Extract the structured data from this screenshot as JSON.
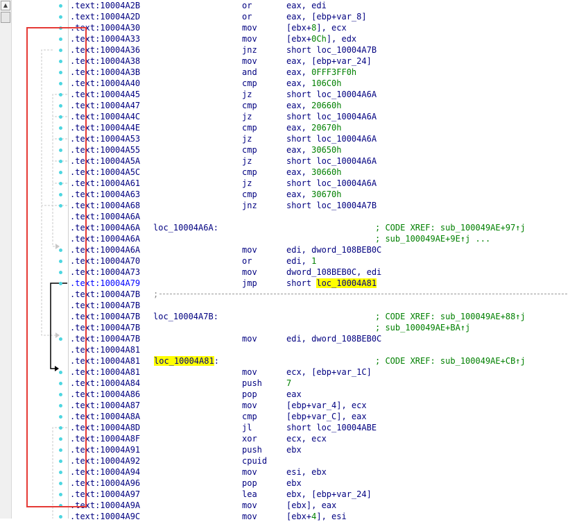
{
  "scrollbar": {
    "up_arrow": "▲"
  },
  "rows": [
    {
      "addr": ".text:10004A2B",
      "label": "",
      "mnemonic": "or",
      "operands": "eax, edi",
      "comment": ""
    },
    {
      "addr": ".text:10004A2D",
      "label": "",
      "mnemonic": "or",
      "operands": "eax, [ebp+var_8]",
      "comment": ""
    },
    {
      "addr": ".text:10004A30",
      "label": "",
      "mnemonic": "mov",
      "operands": "[ebx+8], ecx",
      "comment": ""
    },
    {
      "addr": ".text:10004A33",
      "label": "",
      "mnemonic": "mov",
      "operands": "[ebx+0Ch], edx",
      "comment": ""
    },
    {
      "addr": ".text:10004A36",
      "label": "",
      "mnemonic": "jnz",
      "operands": "short loc_10004A7B",
      "comment": ""
    },
    {
      "addr": ".text:10004A38",
      "label": "",
      "mnemonic": "mov",
      "operands": "eax, [ebp+var_24]",
      "comment": ""
    },
    {
      "addr": ".text:10004A3B",
      "label": "",
      "mnemonic": "and",
      "operands": "eax, 0FFF3FF0h",
      "comment": ""
    },
    {
      "addr": ".text:10004A40",
      "label": "",
      "mnemonic": "cmp",
      "operands": "eax, 106C0h",
      "comment": ""
    },
    {
      "addr": ".text:10004A45",
      "label": "",
      "mnemonic": "jz",
      "operands": "short loc_10004A6A",
      "comment": ""
    },
    {
      "addr": ".text:10004A47",
      "label": "",
      "mnemonic": "cmp",
      "operands": "eax, 20660h",
      "comment": ""
    },
    {
      "addr": ".text:10004A4C",
      "label": "",
      "mnemonic": "jz",
      "operands": "short loc_10004A6A",
      "comment": ""
    },
    {
      "addr": ".text:10004A4E",
      "label": "",
      "mnemonic": "cmp",
      "operands": "eax, 20670h",
      "comment": ""
    },
    {
      "addr": ".text:10004A53",
      "label": "",
      "mnemonic": "jz",
      "operands": "short loc_10004A6A",
      "comment": ""
    },
    {
      "addr": ".text:10004A55",
      "label": "",
      "mnemonic": "cmp",
      "operands": "eax, 30650h",
      "comment": ""
    },
    {
      "addr": ".text:10004A5A",
      "label": "",
      "mnemonic": "jz",
      "operands": "short loc_10004A6A",
      "comment": ""
    },
    {
      "addr": ".text:10004A5C",
      "label": "",
      "mnemonic": "cmp",
      "operands": "eax, 30660h",
      "comment": ""
    },
    {
      "addr": ".text:10004A61",
      "label": "",
      "mnemonic": "jz",
      "operands": "short loc_10004A6A",
      "comment": ""
    },
    {
      "addr": ".text:10004A63",
      "label": "",
      "mnemonic": "cmp",
      "operands": "eax, 30670h",
      "comment": ""
    },
    {
      "addr": ".text:10004A68",
      "label": "",
      "mnemonic": "jnz",
      "operands": "short loc_10004A7B",
      "comment": ""
    },
    {
      "addr": ".text:10004A6A",
      "label": "",
      "mnemonic": "",
      "operands": "",
      "comment": ""
    },
    {
      "addr": ".text:10004A6A",
      "label": "loc_10004A6A:",
      "mnemonic": "",
      "operands": "",
      "comment": "; CODE XREF: sub_100049AE+97↑j"
    },
    {
      "addr": ".text:10004A6A",
      "label": "",
      "mnemonic": "",
      "operands": "",
      "comment": "; sub_100049AE+9E↑j ..."
    },
    {
      "addr": ".text:10004A6A",
      "label": "",
      "mnemonic": "mov",
      "operands": "edi, dword_108BEB0C",
      "comment": ""
    },
    {
      "addr": ".text:10004A70",
      "label": "",
      "mnemonic": "or",
      "operands": "edi, 1",
      "comment": ""
    },
    {
      "addr": ".text:10004A73",
      "label": "",
      "mnemonic": "mov",
      "operands": "dword_108BEB0C, edi",
      "comment": ""
    },
    {
      "addr": ".text:10004A79",
      "label": "",
      "mnemonic": "jmp",
      "operands": "short ",
      "operand_hl": "loc_10004A81",
      "comment": ""
    },
    {
      "addr": ".text:10004A7B",
      "label": "",
      "mnemonic": "",
      "operands": "",
      "comment": "",
      "separator": ";"
    },
    {
      "addr": ".text:10004A7B",
      "label": "",
      "mnemonic": "",
      "operands": "",
      "comment": ""
    },
    {
      "addr": ".text:10004A7B",
      "label": "loc_10004A7B:",
      "mnemonic": "",
      "operands": "",
      "comment": "; CODE XREF: sub_100049AE+88↑j"
    },
    {
      "addr": ".text:10004A7B",
      "label": "",
      "mnemonic": "",
      "operands": "",
      "comment": "; sub_100049AE+BA↑j"
    },
    {
      "addr": ".text:10004A7B",
      "label": "",
      "mnemonic": "mov",
      "operands": "edi, dword_108BEB0C",
      "comment": ""
    },
    {
      "addr": ".text:10004A81",
      "label": "",
      "mnemonic": "",
      "operands": "",
      "comment": ""
    },
    {
      "addr": ".text:10004A81",
      "label": "loc_10004A81:",
      "label_hl": true,
      "mnemonic": "",
      "operands": "",
      "comment": "; CODE XREF: sub_100049AE+CB↑j"
    },
    {
      "addr": ".text:10004A81",
      "label": "",
      "mnemonic": "mov",
      "operands": "ecx, [ebp+var_1C]",
      "comment": ""
    },
    {
      "addr": ".text:10004A84",
      "label": "",
      "mnemonic": "push",
      "operands": "7",
      "comment": ""
    },
    {
      "addr": ".text:10004A86",
      "label": "",
      "mnemonic": "pop",
      "operands": "eax",
      "comment": ""
    },
    {
      "addr": ".text:10004A87",
      "label": "",
      "mnemonic": "mov",
      "operands": "[ebp+var_4], ecx",
      "comment": ""
    },
    {
      "addr": ".text:10004A8A",
      "label": "",
      "mnemonic": "cmp",
      "operands": "[ebp+var_C], eax",
      "comment": ""
    },
    {
      "addr": ".text:10004A8D",
      "label": "",
      "mnemonic": "jl",
      "operands": "short loc_10004ABE",
      "comment": ""
    },
    {
      "addr": ".text:10004A8F",
      "label": "",
      "mnemonic": "xor",
      "operands": "ecx, ecx",
      "comment": ""
    },
    {
      "addr": ".text:10004A91",
      "label": "",
      "mnemonic": "push",
      "operands": "ebx",
      "comment": ""
    },
    {
      "addr": ".text:10004A92",
      "label": "",
      "mnemonic": "cpuid",
      "operands": "",
      "comment": ""
    },
    {
      "addr": ".text:10004A94",
      "label": "",
      "mnemonic": "mov",
      "operands": "esi, ebx",
      "comment": ""
    },
    {
      "addr": ".text:10004A96",
      "label": "",
      "mnemonic": "pop",
      "operands": "ebx",
      "comment": ""
    },
    {
      "addr": ".text:10004A97",
      "label": "",
      "mnemonic": "lea",
      "operands": "ebx, [ebp+var_24]",
      "comment": ""
    },
    {
      "addr": ".text:10004A9A",
      "label": "",
      "mnemonic": "mov",
      "operands": "[ebx], eax",
      "comment": ""
    },
    {
      "addr": ".text:10004A9C",
      "label": "",
      "mnemonic": "mov",
      "operands": "[ebx+4], esi",
      "comment": ""
    }
  ],
  "dotted_rows": [
    0,
    1,
    2,
    3,
    4,
    5,
    6,
    7,
    8,
    9,
    10,
    11,
    12,
    13,
    14,
    15,
    16,
    17,
    18,
    22,
    23,
    24,
    25,
    30,
    33,
    34,
    35,
    36,
    37,
    38,
    39,
    40,
    41,
    42,
    43,
    44,
    45,
    46
  ],
  "colors": {
    "address": "#000080",
    "constant": "#008000",
    "comment": "#008000",
    "highlight": "#ffff00",
    "flow_dot": "#4dd6e0",
    "selection_box": "#e53935"
  }
}
